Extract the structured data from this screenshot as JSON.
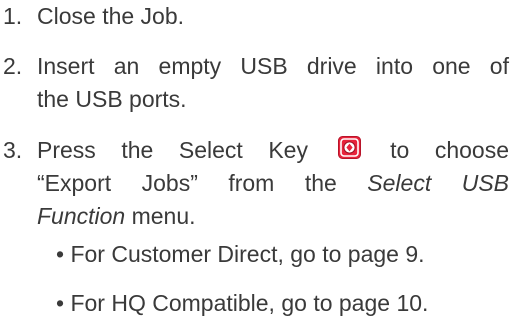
{
  "steps": [
    {
      "number": "1.",
      "text": "Close the Job."
    },
    {
      "number": "2.",
      "line1": "Insert an empty USB drive into one of",
      "line2": "the USB ports."
    },
    {
      "number": "3.",
      "line1_before_icon": "Press the Select Key",
      "line1_after_icon": "to choose",
      "line2_part1": "“Export Jobs” from the",
      "line2_italic": "Select USB",
      "line3_italic": "Function",
      "line3_rest": " menu."
    }
  ],
  "bullets": [
    "• For Customer Direct, go to page 9.",
    "• For HQ Compatible, go to page 10."
  ],
  "icons": {
    "select_key": "select-key-icon"
  },
  "colors": {
    "text": "#3a3a3a",
    "key_red": "#e8243c"
  }
}
